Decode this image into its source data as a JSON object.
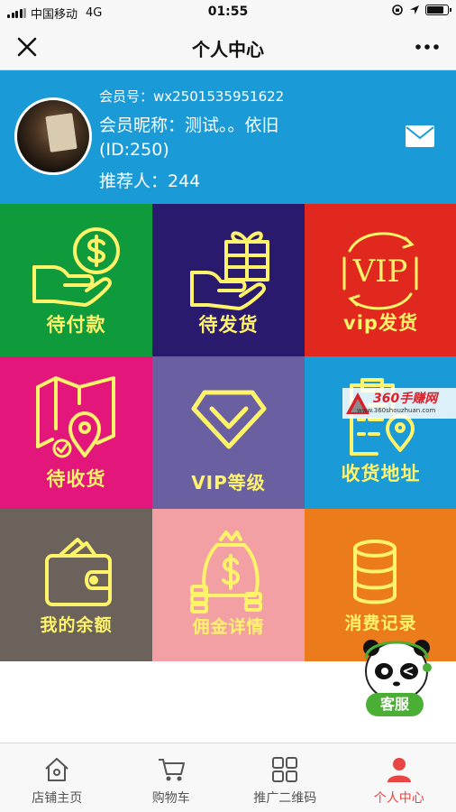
{
  "status_bar": {
    "carrier": "中国移动",
    "network": "4G",
    "time": "01:55",
    "battery_level": 0.9
  },
  "nav": {
    "title": "个人中心",
    "close_icon": "close-icon",
    "more_icon": "more-dots-icon"
  },
  "profile": {
    "member_id": "会员号：wx2501535951622",
    "nickname": "会员昵称：测试。。依旧",
    "user_id": "(ID:250)",
    "referrer": "推荐人：244",
    "mail_icon": "mail-icon",
    "bg_color": "#1a9ad6"
  },
  "grid": {
    "tiles": [
      {
        "label": "待付款",
        "icon": "payment-hand-icon",
        "color": "#0f9b3c"
      },
      {
        "label": "待发货",
        "icon": "gift-hand-icon",
        "color": "#2a1a6e"
      },
      {
        "label": "vip发货",
        "icon": "vip-cycle-icon",
        "color": "#e0281f"
      },
      {
        "label": "待收货",
        "icon": "map-pin-icon",
        "color": "#e3167c"
      },
      {
        "label": "VIP等级",
        "icon": "diamond-icon",
        "color": "#6a5fa0"
      },
      {
        "label": "收货地址",
        "icon": "address-clipboard-icon",
        "color": "#1a9ad6"
      },
      {
        "label": "我的余额",
        "icon": "wallet-icon",
        "color": "#6b625c"
      },
      {
        "label": "佣金详情",
        "icon": "money-bag-icon",
        "color": "#f2a0a3"
      },
      {
        "label": "消费记录",
        "icon": "database-icon",
        "color": "#ec7b1c"
      }
    ],
    "label_color": "#fff36a"
  },
  "watermark": {
    "name": "360手赚网",
    "url": "www.360shouzhuan.com"
  },
  "support": {
    "label": "客服",
    "icon": "panda-support-icon"
  },
  "tabbar": {
    "tabs": [
      {
        "label": "店铺主页",
        "icon": "home-icon"
      },
      {
        "label": "购物车",
        "icon": "cart-icon"
      },
      {
        "label": "推广二维码",
        "icon": "qrcode-icon"
      },
      {
        "label": "个人中心",
        "icon": "user-icon"
      }
    ],
    "active_index": 3,
    "active_color": "#e84545"
  }
}
